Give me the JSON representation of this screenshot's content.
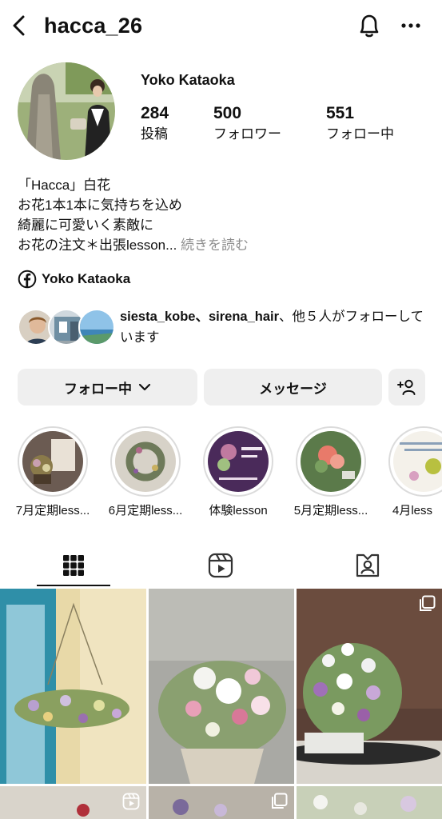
{
  "header": {
    "username": "hacca_26"
  },
  "profile": {
    "display_name": "Yoko Kataoka",
    "stats": [
      {
        "value": "284",
        "label": "投稿"
      },
      {
        "value": "500",
        "label": "フォロワー"
      },
      {
        "value": "551",
        "label": "フォロー中"
      }
    ],
    "bio_lines": [
      "「Hacca」白花",
      "お花1本1本に気持ちを込め",
      "綺麗に可愛いく素敵に",
      "お花の注文＊出張lesson..."
    ],
    "bio_more": "続きを読む",
    "facebook_name": "Yoko Kataoka",
    "mutual": {
      "names": "siesta_kobe、sirena_hair",
      "rest": "、他５人がフォローしています"
    }
  },
  "actions": {
    "follow_label": "フォロー中",
    "message_label": "メッセージ"
  },
  "highlights": [
    {
      "label": "7月定期less..."
    },
    {
      "label": "6月定期less..."
    },
    {
      "label": "体験lesson"
    },
    {
      "label": "5月定期less..."
    },
    {
      "label": "4月less"
    }
  ],
  "tabs": [
    "posts-grid",
    "reels",
    "tagged"
  ],
  "colors": {
    "button_bg": "#efefef",
    "secondary_text": "#8e8e8e",
    "highlight_ring": "#dbdbdb"
  }
}
